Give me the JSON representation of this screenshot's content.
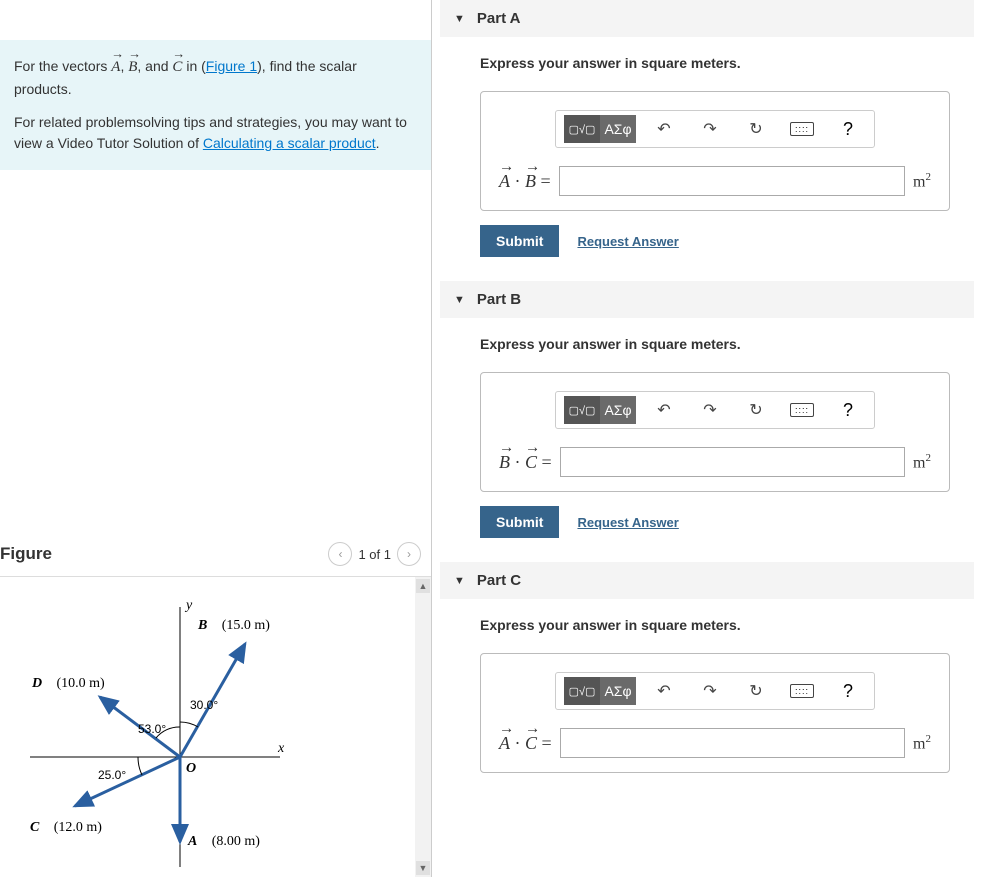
{
  "problem": {
    "intro_prefix": "For the vectors ",
    "intro_middle": " in (",
    "figure_link": "Figure 1",
    "intro_suffix": "), find the scalar products.",
    "tips_text": "For related problemsolving tips and strategies, you may want to view a Video Tutor Solution of ",
    "tips_link": "Calculating a scalar product",
    "tips_period": "."
  },
  "figure": {
    "title": "Figure",
    "pager": "1 of 1",
    "labels": {
      "y": "y",
      "x": "x",
      "origin": "O",
      "B": "(15.0 m)",
      "D": "(10.0 m)",
      "C": "(12.0 m)",
      "A": "(8.00 m)",
      "ang_B": "30.0°",
      "ang_D": "53.0°",
      "ang_C": "25.0°"
    }
  },
  "toolbar": {
    "greek": "ΑΣφ",
    "undo": "↶",
    "redo": "↷",
    "reset": "↻",
    "keyboard": "⌨",
    "help": "?"
  },
  "parts": [
    {
      "title": "Part A",
      "instruction": "Express your answer in square meters.",
      "lhs_a": "A",
      "lhs_b": "B",
      "unit": "m",
      "unit_sup": "2",
      "submit": "Submit",
      "request": "Request Answer"
    },
    {
      "title": "Part B",
      "instruction": "Express your answer in square meters.",
      "lhs_a": "B",
      "lhs_b": "C",
      "unit": "m",
      "unit_sup": "2",
      "submit": "Submit",
      "request": "Request Answer"
    },
    {
      "title": "Part C",
      "instruction": "Express your answer in square meters.",
      "lhs_a": "A",
      "lhs_b": "C",
      "unit": "m",
      "unit_sup": "2",
      "submit": "Submit",
      "request": "Request Answer"
    }
  ]
}
